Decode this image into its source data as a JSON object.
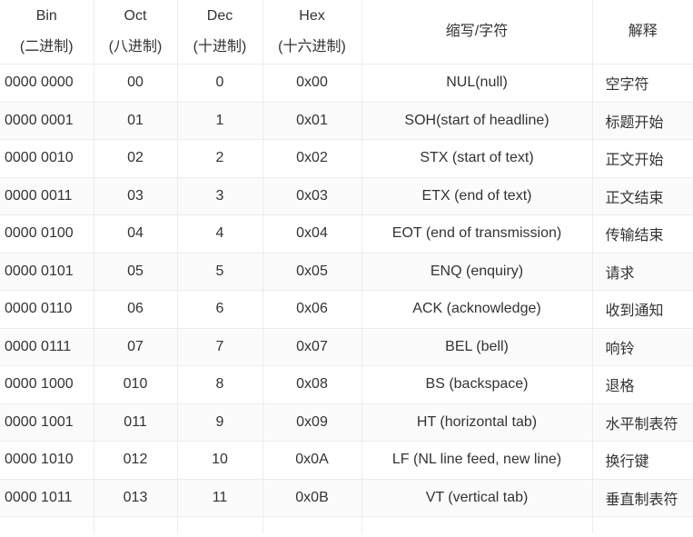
{
  "headers": {
    "bin": [
      "Bin",
      "(二进制)"
    ],
    "oct": [
      "Oct",
      "(八进制)"
    ],
    "dec": [
      "Dec",
      "(十进制)"
    ],
    "hex": [
      "Hex",
      "(十六进制)"
    ],
    "abbr": "缩写/字符",
    "desc": "解释"
  },
  "rows": [
    {
      "bin": "0000 0000",
      "oct": "00",
      "dec": "0",
      "hex": "0x00",
      "abbr": "NUL(null)",
      "desc": "空字符"
    },
    {
      "bin": "0000 0001",
      "oct": "01",
      "dec": "1",
      "hex": "0x01",
      "abbr": "SOH(start of headline)",
      "desc": "标题开始"
    },
    {
      "bin": "0000 0010",
      "oct": "02",
      "dec": "2",
      "hex": "0x02",
      "abbr": "STX (start of text)",
      "desc": "正文开始"
    },
    {
      "bin": "0000 0011",
      "oct": "03",
      "dec": "3",
      "hex": "0x03",
      "abbr": "ETX (end of text)",
      "desc": "正文结束"
    },
    {
      "bin": "0000 0100",
      "oct": "04",
      "dec": "4",
      "hex": "0x04",
      "abbr": "EOT (end of transmission)",
      "desc": "传输结束"
    },
    {
      "bin": "0000 0101",
      "oct": "05",
      "dec": "5",
      "hex": "0x05",
      "abbr": "ENQ (enquiry)",
      "desc": "请求"
    },
    {
      "bin": "0000 0110",
      "oct": "06",
      "dec": "6",
      "hex": "0x06",
      "abbr": "ACK (acknowledge)",
      "desc": "收到通知"
    },
    {
      "bin": "0000 0111",
      "oct": "07",
      "dec": "7",
      "hex": "0x07",
      "abbr": "BEL (bell)",
      "desc": "响铃"
    },
    {
      "bin": "0000 1000",
      "oct": "010",
      "dec": "8",
      "hex": "0x08",
      "abbr": "BS (backspace)",
      "desc": "退格"
    },
    {
      "bin": "0000 1001",
      "oct": "011",
      "dec": "9",
      "hex": "0x09",
      "abbr": "HT (horizontal tab)",
      "desc": "水平制表符"
    },
    {
      "bin": "0000 1010",
      "oct": "012",
      "dec": "10",
      "hex": "0x0A",
      "abbr": "LF (NL line feed, new line)",
      "desc": "换行键"
    },
    {
      "bin": "0000 1011",
      "oct": "013",
      "dec": "11",
      "hex": "0x0B",
      "abbr": "VT (vertical tab)",
      "desc": "垂直制表符"
    }
  ]
}
